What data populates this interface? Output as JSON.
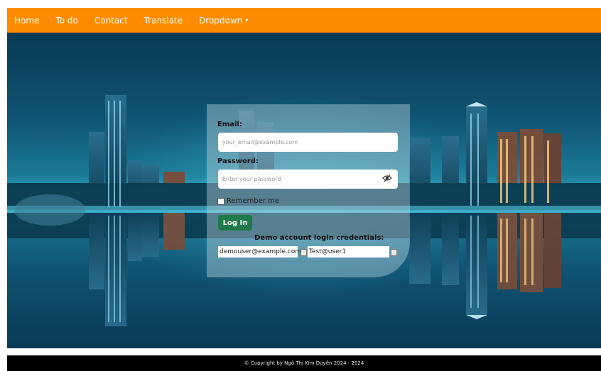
{
  "nav": {
    "items": [
      {
        "label": "Home"
      },
      {
        "label": "To do"
      },
      {
        "label": "Contact"
      },
      {
        "label": "Translate"
      },
      {
        "label": "Dropdown"
      }
    ],
    "caret": "▾"
  },
  "login": {
    "email_label": "Email:",
    "email_placeholder": "your_email@example.com",
    "password_label": "Password:",
    "password_placeholder": "Enter your password",
    "remember_label": "Remember me",
    "login_button": "Log In",
    "demo_title": "Demo account login credentials:",
    "demo_email": "demouser@example.com",
    "demo_password": "Test@user1"
  },
  "footer": {
    "text": "© Copyright by Ngô Thị Kim Duyên 2024 - 2024"
  },
  "colors": {
    "nav_bg": "#ff8c00",
    "button_bg": "#1e7a4a",
    "footer_bg": "#000000"
  }
}
